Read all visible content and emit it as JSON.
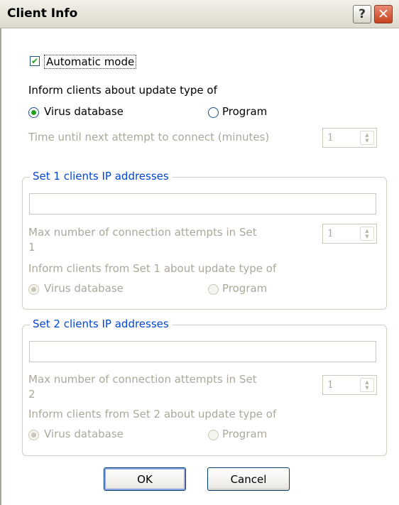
{
  "window": {
    "title": "Client Info",
    "help_glyph": "?",
    "close_glyph": "✕"
  },
  "automatic_mode": {
    "label": "Automatic mode",
    "checked": true
  },
  "inform_label": "Inform clients about update type of",
  "update_type": {
    "virus_database": "Virus database",
    "program": "Program",
    "selected": "virus_database"
  },
  "time_until_label": "Time until next attempt to connect (minutes)",
  "time_until_value": "1",
  "set1": {
    "legend": "Set 1 clients IP addresses",
    "ip_value": "",
    "max_attempts_label_line1": "Max number of connection attempts in Set",
    "max_attempts_label_line2": "1",
    "max_attempts_value": "1",
    "inform_label": "Inform clients from Set 1 about update type of",
    "virus_database": "Virus database",
    "program": "Program"
  },
  "set2": {
    "legend": "Set 2 clients IP addresses",
    "ip_value": "",
    "max_attempts_label_line1": "Max number of connection attempts in Set",
    "max_attempts_label_line2": "2",
    "max_attempts_value": "1",
    "inform_label": "Inform clients from Set 2 about update type of",
    "virus_database": "Virus database",
    "program": "Program"
  },
  "buttons": {
    "ok": "OK",
    "cancel": "Cancel"
  },
  "icons": {
    "check": "checkmark-icon",
    "spin_up": "spin-up-icon",
    "spin_down": "spin-down-icon"
  }
}
